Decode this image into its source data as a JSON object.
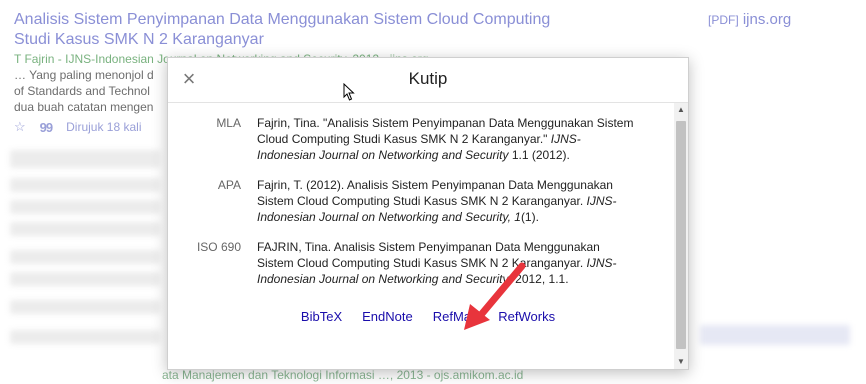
{
  "result": {
    "title_line1": "Analisis Sistem Penyimpanan Data Menggunakan Sistem Cloud Computing",
    "title_line2": "Studi Kasus SMK N 2 Karanganyar",
    "authors": "T Fajrin - IJNS-Indonesian Journal on Networking and Security, 2012 - ijns.org",
    "snippet_lines": [
      "… Yang paling menonjol d",
      "of Standards and Technol",
      "dua buah catatan mengen"
    ],
    "cited_by": "Dirujuk 18 kali",
    "pdf_tag": "[PDF]",
    "pdf_domain": "ijns.org",
    "bottom_line": "ata Manajemen dan Teknologi Informasi …, 2013 - ojs.amikom.ac.id"
  },
  "dialog": {
    "title": "Kutip",
    "close_icon": "close-icon",
    "citations": [
      {
        "label": "MLA",
        "text_plain": "Fajrin, Tina. \"Analisis Sistem Penyimpanan Data Menggunakan Sistem Cloud Computing Studi Kasus SMK N 2 Karanganyar.\" ",
        "text_italic": "IJNS-Indonesian Journal on Networking and Security",
        "text_tail": " 1.1 (2012)."
      },
      {
        "label": "APA",
        "text_plain": "Fajrin, T. (2012). Analisis Sistem Penyimpanan Data Menggunakan Sistem Cloud Computing Studi Kasus SMK N 2 Karanganyar. ",
        "text_italic": "IJNS-Indonesian Journal on Networking and Security, 1",
        "text_tail": "(1)."
      },
      {
        "label": "ISO 690",
        "text_plain": "FAJRIN, Tina. Analisis Sistem Penyimpanan Data Menggunakan Sistem Cloud Computing Studi Kasus SMK N 2 Karanganyar. ",
        "text_italic": "IJNS-Indonesian Journal on Networking and Security",
        "text_tail": ", 2012, 1.1."
      }
    ],
    "formats": [
      "BibTeX",
      "EndNote",
      "RefMan",
      "RefWorks"
    ]
  },
  "colors": {
    "link": "#1a0dab",
    "annotation_arrow": "#e8343c"
  }
}
